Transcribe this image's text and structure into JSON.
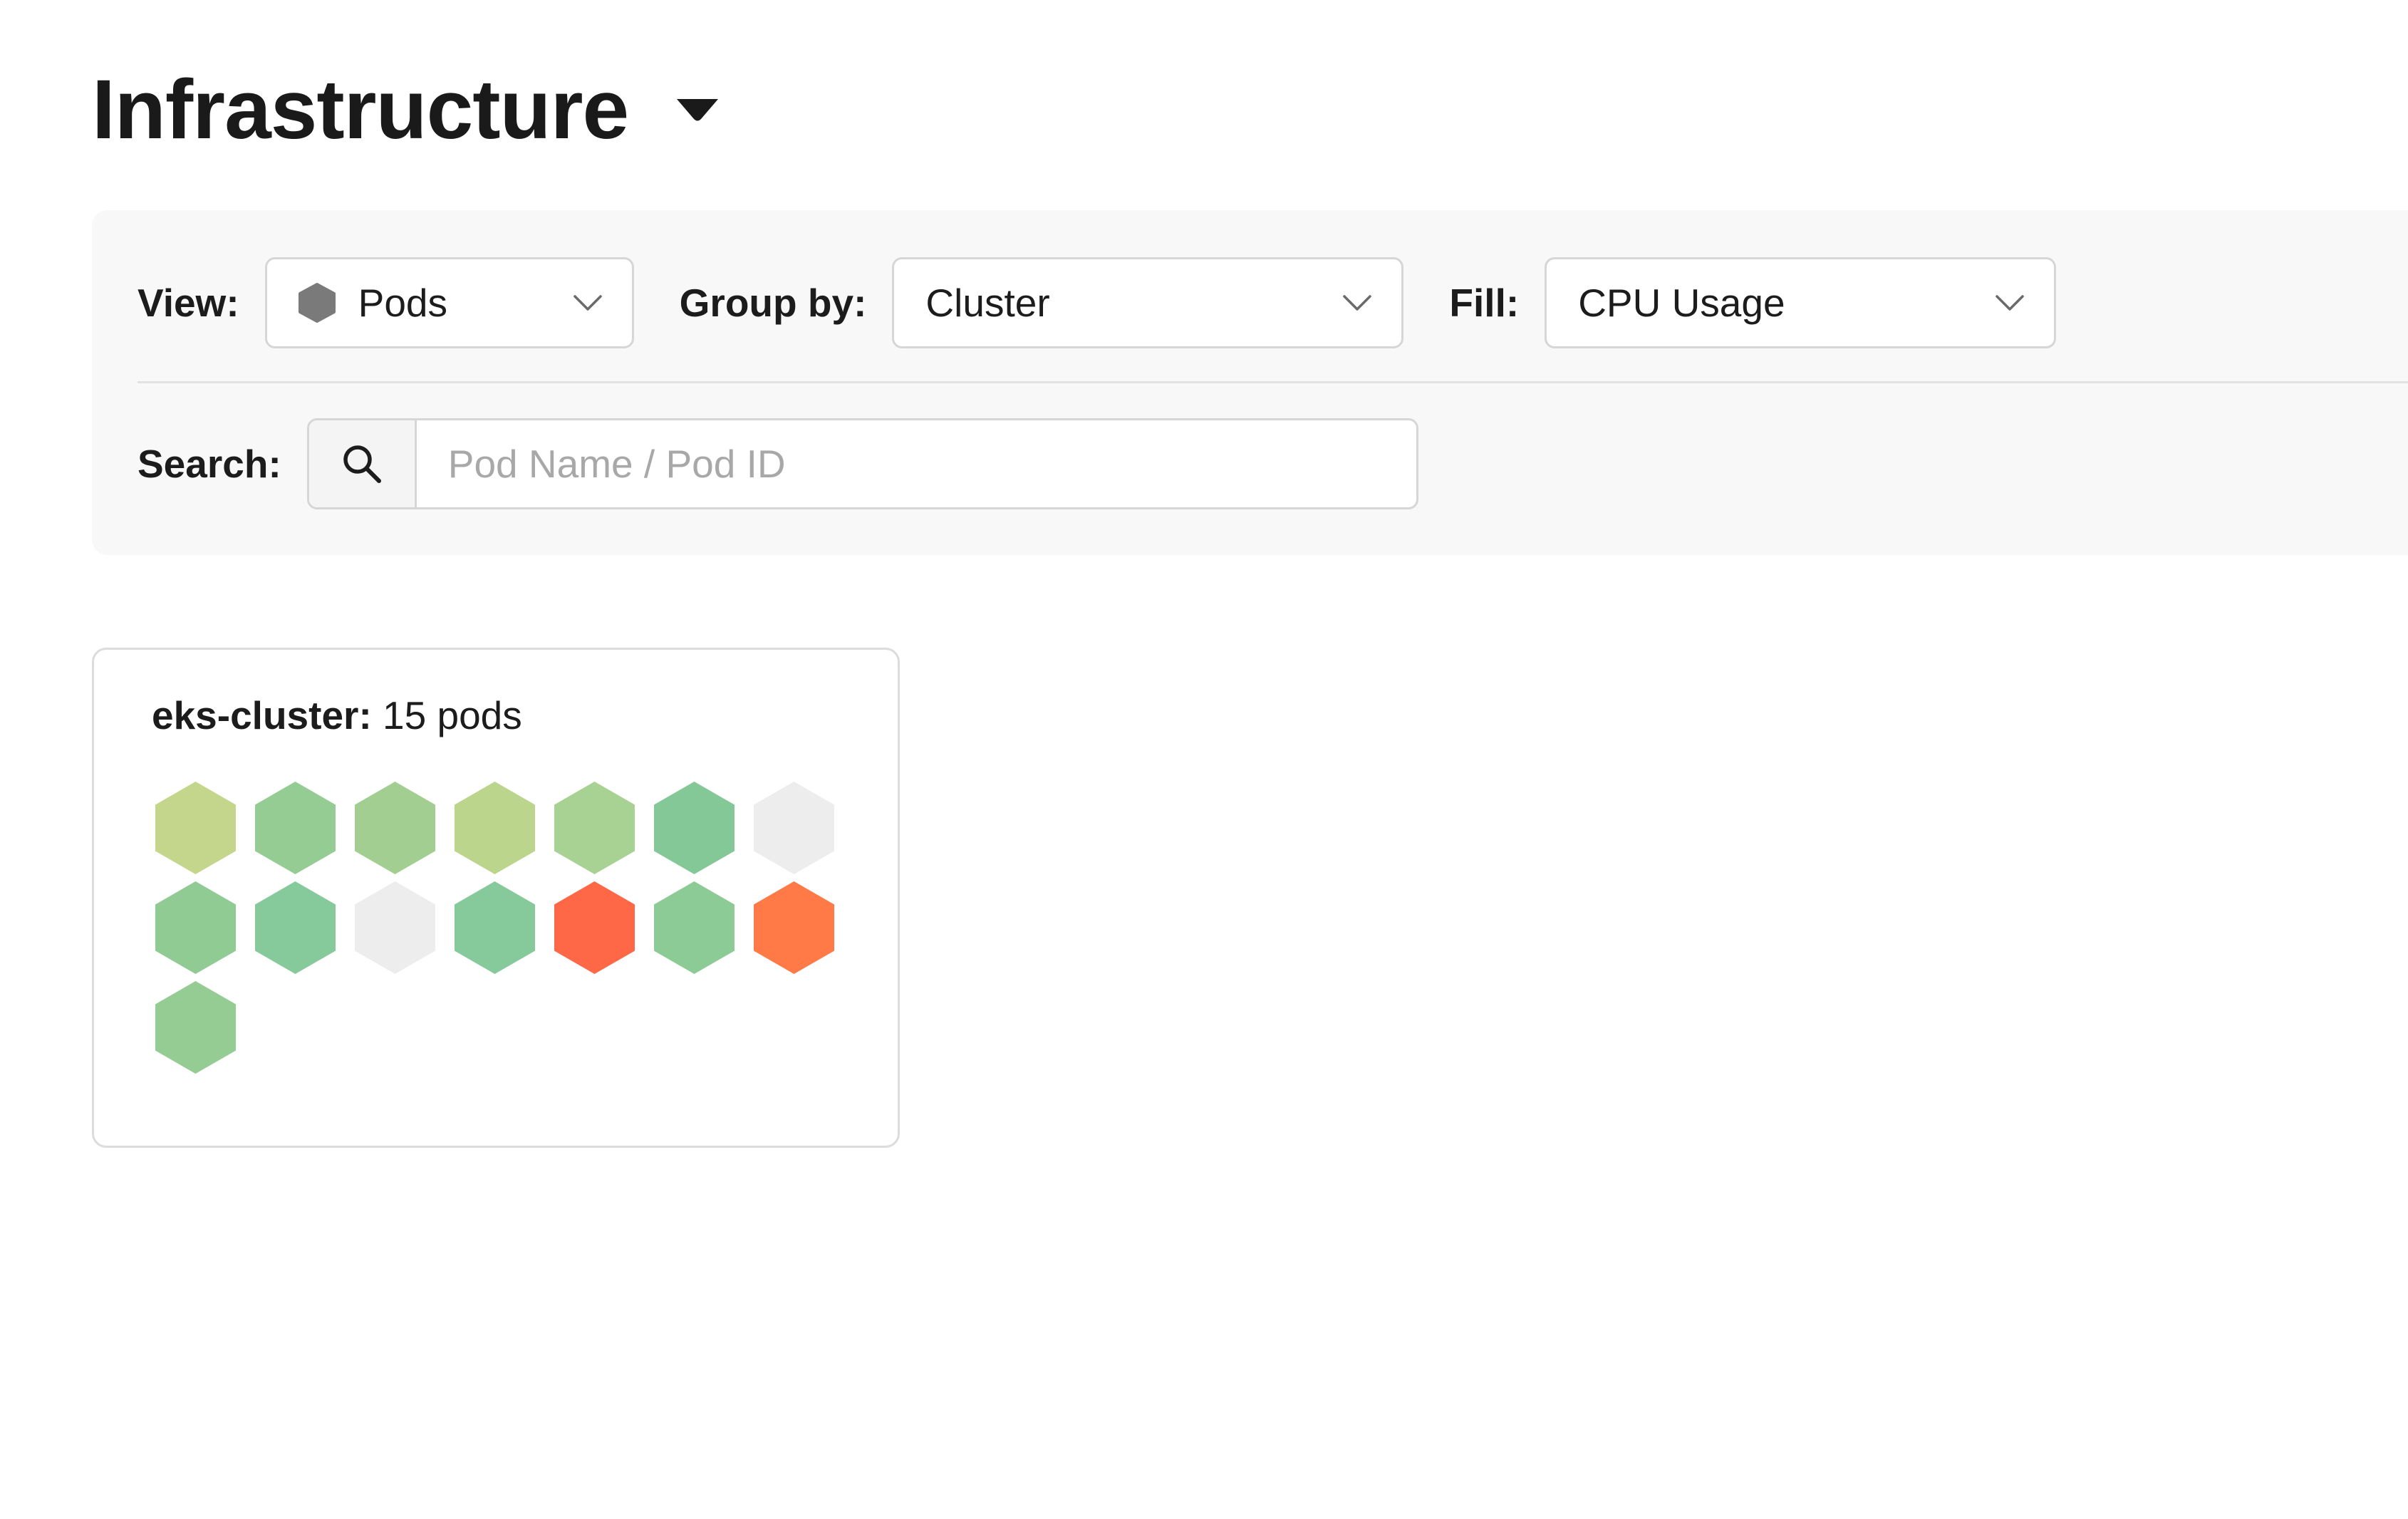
{
  "header": {
    "title": "Infrastructure"
  },
  "filters": {
    "view": {
      "label": "View:",
      "value": "Pods",
      "icon": "pod-hexagon-icon"
    },
    "group_by": {
      "label": "Group by:",
      "value": "Cluster"
    },
    "fill": {
      "label": "Fill:",
      "value": "CPU Usage"
    },
    "search": {
      "label": "Search:",
      "placeholder": "Pod Name / Pod ID",
      "value": ""
    }
  },
  "cluster": {
    "name": "eks-cluster:",
    "pod_count_text": "15 pods",
    "pods": [
      {
        "fill_color": "#c3d68c"
      },
      {
        "fill_color": "#94cc93"
      },
      {
        "fill_color": "#a2cf91"
      },
      {
        "fill_color": "#bbd58c"
      },
      {
        "fill_color": "#a8d293"
      },
      {
        "fill_color": "#84c898"
      },
      {
        "fill_color": "#ededed"
      },
      {
        "fill_color": "#90cb94"
      },
      {
        "fill_color": "#86c99a"
      },
      {
        "fill_color": "#ededed"
      },
      {
        "fill_color": "#86c99a"
      },
      {
        "fill_color": "#ff6846"
      },
      {
        "fill_color": "#8ccb95"
      },
      {
        "fill_color": "#ff7a46"
      },
      {
        "fill_color": "#94cc93"
      }
    ]
  },
  "colors": {
    "toolbar_bg": "#f8f8f8",
    "border": "#d6d6d6",
    "pod_icon": "#7a7a7a"
  }
}
